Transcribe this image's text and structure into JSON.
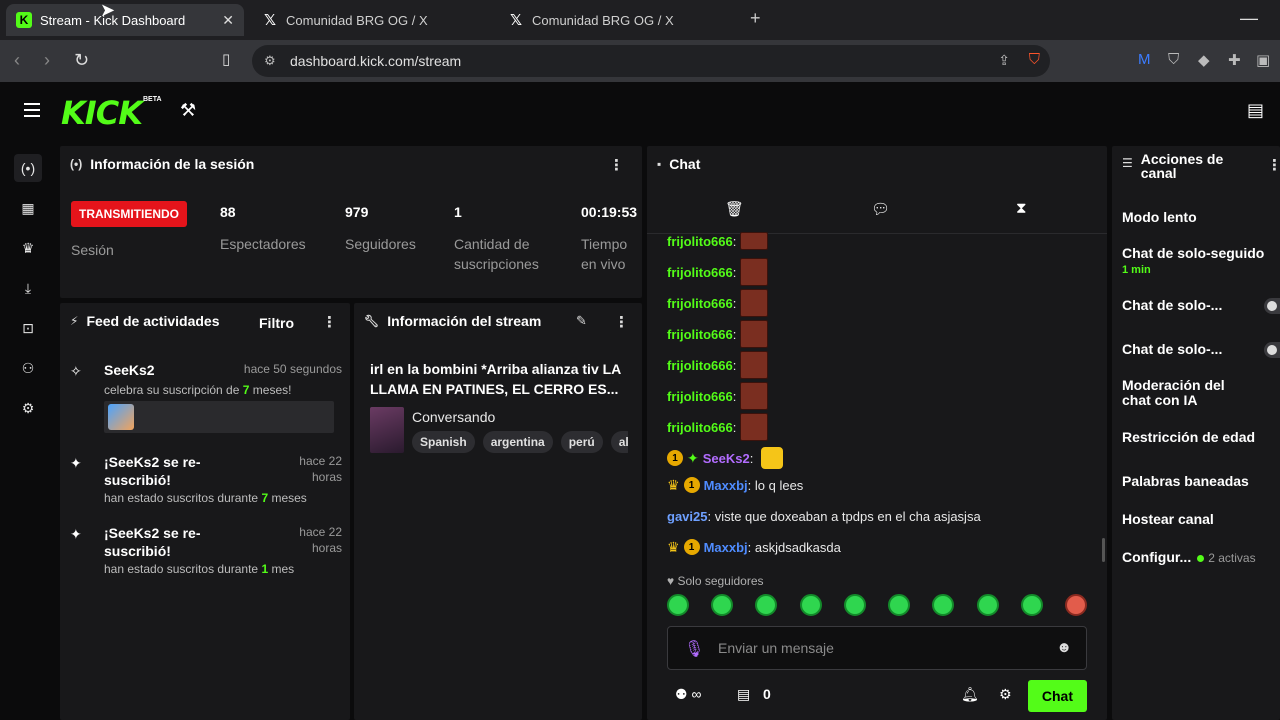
{
  "browser": {
    "tabs": [
      {
        "title": "Stream - Kick Dashboard",
        "favicon": "kick-icon"
      },
      {
        "title": "Comunidad BRG OG / X",
        "favicon": "x-icon"
      },
      {
        "title": "Comunidad BRG OG / X",
        "favicon": "x-icon"
      }
    ],
    "url": "dashboard.kick.com/stream"
  },
  "app": {
    "logo": "KICK",
    "beta": "BETA"
  },
  "session": {
    "title": "Información de la sesión",
    "live_badge": "TRANSMITIENDO",
    "session_label": "Sesión",
    "stats": [
      {
        "value": "88",
        "label": "Espectadores"
      },
      {
        "value": "979",
        "label": "Seguidores"
      },
      {
        "value": "1",
        "label": "Cantidad de suscripciones"
      },
      {
        "value": "00:19:53",
        "label": "Tiempo en vivo"
      }
    ]
  },
  "feed": {
    "title": "Feed de actividades",
    "filter": "Filtro",
    "items": [
      {
        "title": "SeeKs2",
        "time": "hace 50 segundos",
        "desc_pre": "celebra su suscripción de ",
        "desc_num": "7",
        "desc_post": " meses!"
      },
      {
        "title": "¡SeeKs2 se re-suscribió!",
        "time": "hace 22 horas",
        "desc_pre": "han estado suscritos durante ",
        "desc_num": "7",
        "desc_post": " meses"
      },
      {
        "title": "¡SeeKs2 se re-suscribió!",
        "time": "hace 22 horas",
        "desc_pre": "han estado suscritos durante ",
        "desc_num": "1",
        "desc_post": " mes"
      }
    ]
  },
  "stream_info": {
    "title": "Información del stream",
    "stream_title": "irl en la bombini *Arriba alianza tiv LA LLAMA EN PATINES, EL CERRO ES...",
    "category": "Conversando",
    "tags": [
      "Spanish",
      "argentina",
      "perú",
      "al"
    ]
  },
  "chat": {
    "title": "Chat",
    "messages": [
      {
        "user": "frijolito666",
        "text": ""
      },
      {
        "user": "frijolito666",
        "text": ""
      },
      {
        "user": "frijolito666",
        "text": ""
      },
      {
        "user": "frijolito666",
        "text": ""
      },
      {
        "user": "frijolito666",
        "text": ""
      },
      {
        "user": "frijolito666",
        "text": ""
      },
      {
        "user": "frijolito666",
        "text": ""
      },
      {
        "user": "SeeKs2",
        "text": ""
      },
      {
        "user": "Maxxbj",
        "text": "lo q lees"
      },
      {
        "user": "gavi25",
        "text": "viste que doxeaban a tpdps en el cha asjasjsa"
      },
      {
        "user": "Maxxbj",
        "text": "askjdsadkasda"
      }
    ],
    "badge_one": "1",
    "follow_only": "Solo seguidores",
    "placeholder": "Enviar un mensaje",
    "points": "0",
    "send": "Chat"
  },
  "actions": {
    "title": "Acciones de canal",
    "items": [
      {
        "label": "Modo lento",
        "control": "chevron"
      },
      {
        "label": "Chat de solo-seguido",
        "sub": "1 min",
        "control": "chevron"
      },
      {
        "label": "Chat de solo-...",
        "control": "toggle"
      },
      {
        "label": "Chat de solo-...",
        "control": "toggle"
      },
      {
        "label": "Moderación del chat con IA",
        "control": "external"
      },
      {
        "label": "Restricción de edad",
        "control": "chevron"
      },
      {
        "label": "Palabras baneadas",
        "control": "chevron"
      },
      {
        "label": "Hostear canal",
        "control": "none"
      },
      {
        "label": "Configur...",
        "active": "2 activas",
        "control": "chevron"
      }
    ]
  },
  "colors": {
    "accent": "#53fc18",
    "live": "#e5141b",
    "panel": "#18181a"
  }
}
